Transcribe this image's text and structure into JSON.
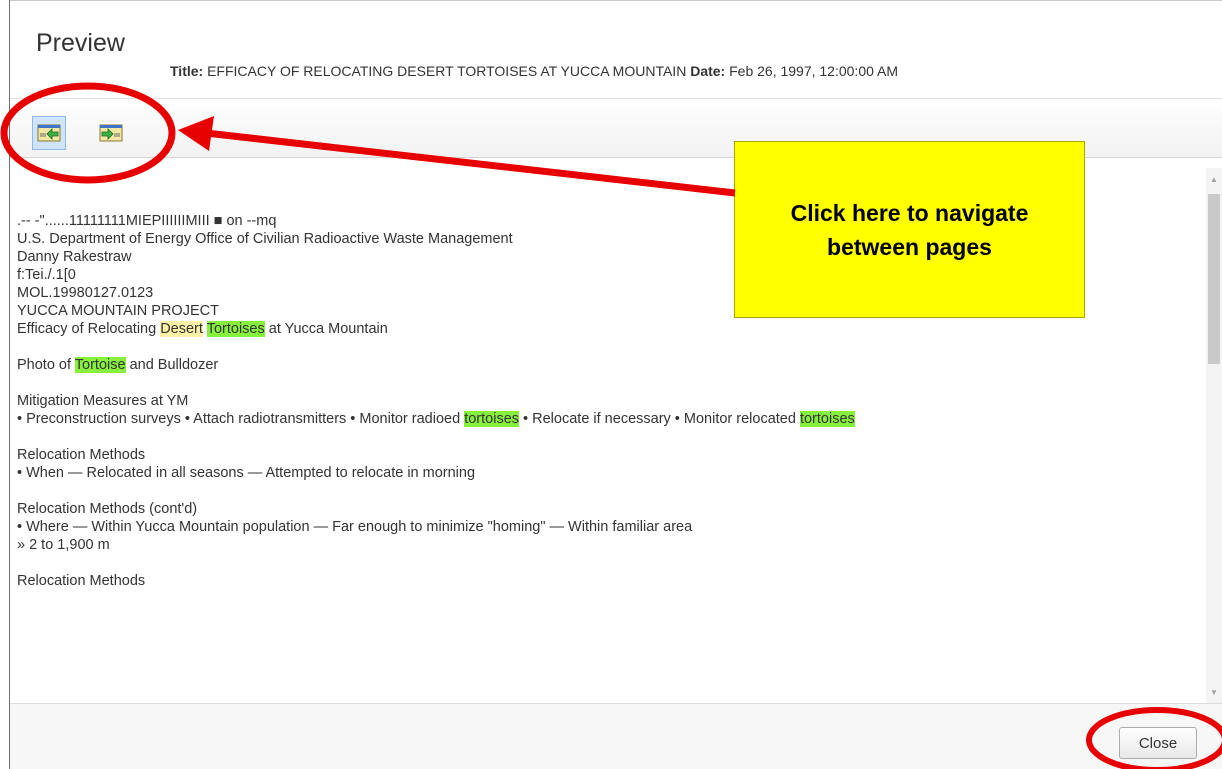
{
  "dialog": {
    "title": "Preview",
    "title_label": "Title:",
    "title_value": "EFFICACY OF RELOCATING DESERT TORTOISES AT YUCCA MOUNTAIN",
    "date_label": "Date:",
    "date_value": "Feb 26, 1997, 12:00:00 AM"
  },
  "toolbar": {
    "buttons": [
      {
        "icon": "previous-page-icon",
        "state": "active"
      },
      {
        "icon": "next-page-icon",
        "state": "normal"
      }
    ]
  },
  "content": {
    "lines": [
      ".-- -\"......11111111MIEPIIIIIIMIII ■ on --mq",
      "U.S. Department of Energy Office of Civilian Radioactive Waste Management",
      "Danny Rakestraw",
      "f:Tei./.1[0",
      "MOL.19980127.0123",
      "YUCCA MOUNTAIN PROJECT"
    ],
    "efficacy": {
      "a": "Efficacy of Relocating ",
      "hl1": "Desert",
      "sp": " ",
      "hl2": "Tortoises",
      "b": " at Yucca Mountain"
    },
    "photo": {
      "a": "Photo of ",
      "hl": "Tortoise",
      "b": " and Bulldozer"
    },
    "mitigation_heading": "Mitigation Measures at YM",
    "mitigation": {
      "a": "• Preconstruction surveys • Attach radiotransmitters • Monitor radioed ",
      "hl1": "tortoises",
      "b": " • Relocate if necessary • Monitor relocated ",
      "hl2": "tortoises"
    },
    "relocation_heading_1": "Relocation Methods",
    "relocation_when": "• When — Relocated in all seasons — Attempted to relocate in morning",
    "relocation_heading_2": "Relocation Methods (cont'd)",
    "relocation_where": "• Where — Within Yucca Mountain population — Far enough to minimize \"homing\" — Within familiar area",
    "relocation_distance": "» 2 to 1,900 m",
    "relocation_heading_3": "Relocation Methods"
  },
  "footer": {
    "close_label": "Close"
  },
  "annotation": {
    "callout_text": "Click here to navigate between pages",
    "color_arrow": "#e60000",
    "color_callout": "#ffff00"
  },
  "colors": {
    "highlight_yellow": "#fff2a8",
    "highlight_green": "#86f03c",
    "text": "#333333"
  }
}
